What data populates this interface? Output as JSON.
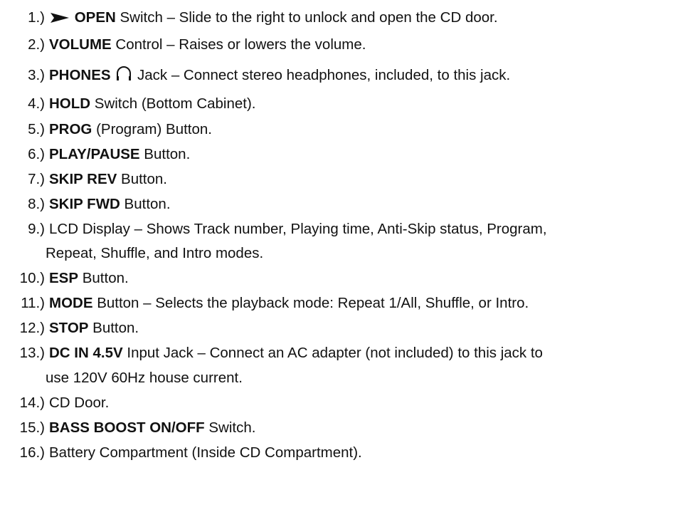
{
  "items": [
    {
      "num": "1.)",
      "bold": "OPEN",
      "rest": " Switch – Slide to the right to unlock and open the CD door.",
      "icon": "play-arrow-icon"
    },
    {
      "num": "2.)",
      "bold": "VOLUME",
      "rest": " Control – Raises or lowers the volume."
    },
    {
      "num": "3.)",
      "bold": "PHONES",
      "rest": " Jack – Connect stereo headphones, included, to this jack.",
      "icon": "headphones-icon"
    },
    {
      "num": "4.)",
      "bold": "HOLD",
      "rest": " Switch (Bottom Cabinet)."
    },
    {
      "num": "5.)",
      "bold": "PROG",
      "rest": " (Program) Button."
    },
    {
      "num": "6.)",
      "bold": "PLAY/PAUSE",
      "rest": " Button."
    },
    {
      "num": "7.)",
      "bold": "SKIP REV",
      "rest": " Button."
    },
    {
      "num": "8.)",
      "bold": "SKIP FWD",
      "rest": " Button."
    },
    {
      "num": "9.)",
      "bold": "",
      "rest": "LCD Display – Shows Track number, Playing time, Anti-Skip status, Program,",
      "rest2": "Repeat, Shuffle, and Intro modes."
    },
    {
      "num": "10.)",
      "bold": "ESP",
      "rest": " Button."
    },
    {
      "num": "11.)",
      "bold": "MODE",
      "rest": " Button – Selects the playback mode: Repeat 1/All, Shuffle, or Intro."
    },
    {
      "num": "12.)",
      "bold": "STOP",
      "rest": " Button."
    },
    {
      "num": "13.)",
      "bold": "DC IN 4.5V",
      "rest": " Input Jack – Connect an AC adapter (not included) to this jack to",
      "rest2": "use 120V 60Hz house current."
    },
    {
      "num": "14.)",
      "bold": "",
      "rest": "CD Door."
    },
    {
      "num": "15.)",
      "bold": "BASS BOOST ON/OFF",
      "rest": " Switch."
    },
    {
      "num": "16.)",
      "bold": "",
      "rest": "Battery Compartment (Inside CD Compartment)."
    }
  ]
}
